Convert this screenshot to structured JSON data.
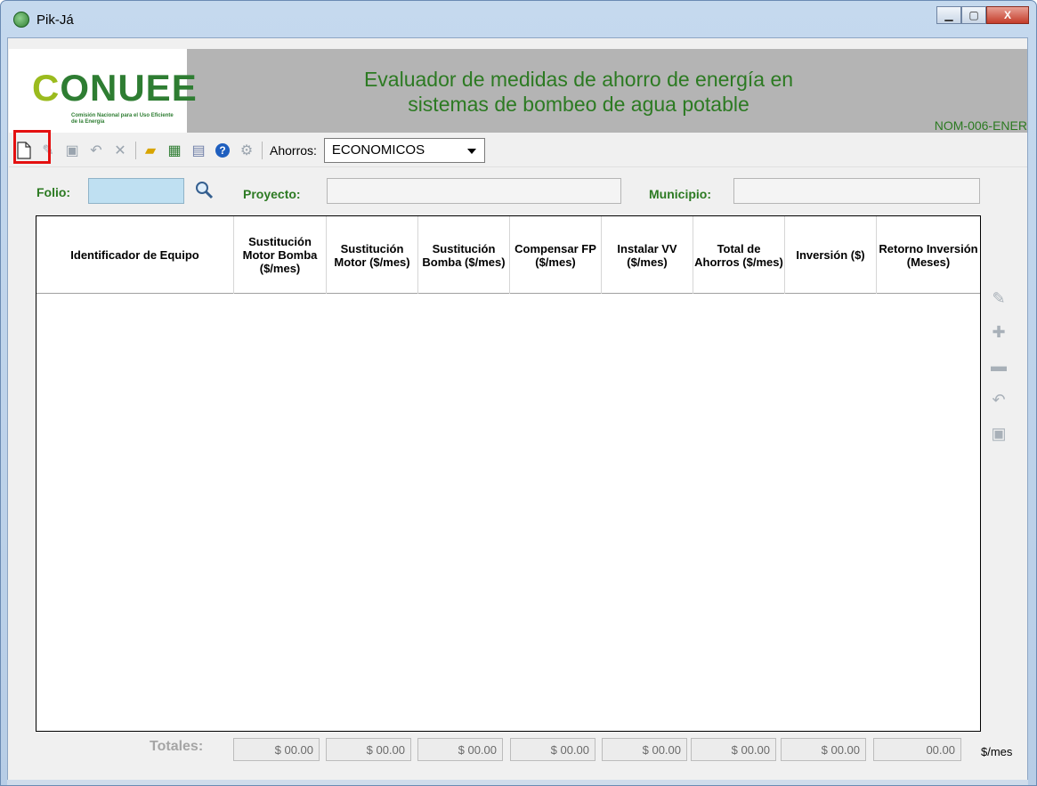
{
  "window": {
    "title": "Pik-Já",
    "minimize": "▁",
    "maximize": "▢",
    "close": "X"
  },
  "banner": {
    "logo_text": "ONUEE",
    "logo_letter": "C",
    "logo_sub": "Comisión Nacional para el Uso Eficiente de la Energía",
    "title_line1": "Evaluador de medidas de ahorro de energía en",
    "title_line2": "sistemas de bombeo de agua potable",
    "nom": "NOM-006-ENER"
  },
  "toolbar": {
    "ahorros_label": "Ahorros:",
    "ahorros_value": "ECONOMICOS"
  },
  "form": {
    "folio_label": "Folio:",
    "folio_value": "",
    "proyecto_label": "Proyecto:",
    "proyecto_value": "",
    "municipio_label": "Municipio:",
    "municipio_value": ""
  },
  "grid": {
    "columns": [
      "Identificador de Equipo",
      "Sustitución Motor Bomba ($/mes)",
      "Sustitución Motor ($/mes)",
      "Sustitución Bomba ($/mes)",
      "Compensar FP ($/mes)",
      "Instalar VV ($/mes)",
      "Total de Ahorros ($/mes)",
      "Inversión ($)",
      "Retorno Inversión (Meses)"
    ],
    "rows": []
  },
  "totals": {
    "label": "Totales:",
    "values": [
      "$ 00.00",
      "$ 00.00",
      "$ 00.00",
      "$ 00.00",
      "$ 00.00",
      "$ 00.00",
      "$ 00.00",
      "00.00"
    ],
    "unit": "$/mes"
  },
  "icons": {
    "toolbar": [
      "new-document-icon",
      "edit-icon",
      "save-icon",
      "undo-icon",
      "delete-icon",
      "open-folder-icon",
      "excel-icon",
      "report-icon",
      "help-icon",
      "settings-icon"
    ],
    "side": [
      "edit-row-icon",
      "add-row-icon",
      "remove-row-icon",
      "undo-row-icon",
      "save-row-icon"
    ]
  },
  "colors": {
    "accent_green": "#2c7a22",
    "highlight": "#e41010",
    "banner_gray": "#b4b4b4"
  }
}
